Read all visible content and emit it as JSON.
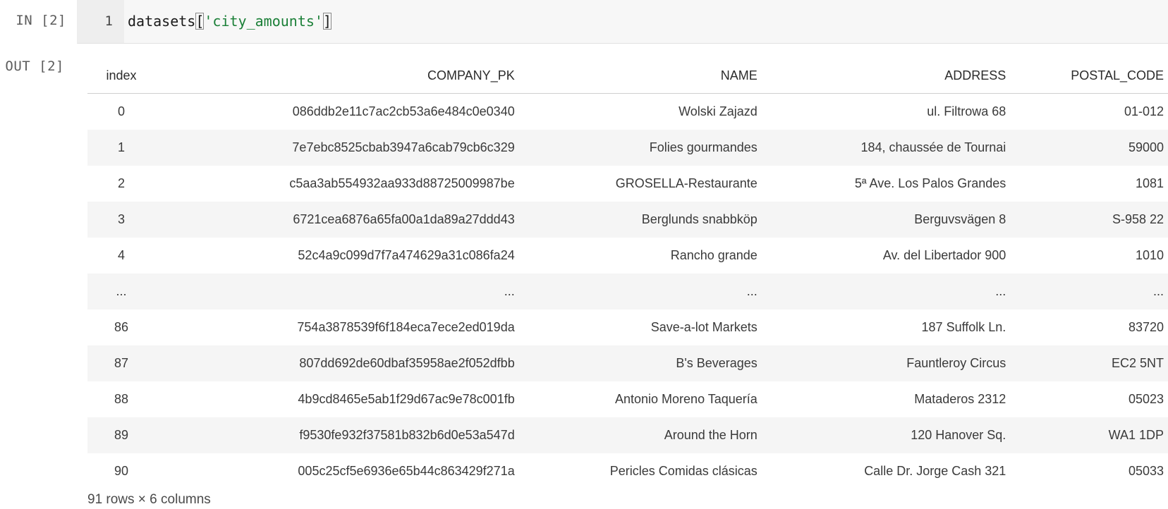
{
  "prompts": {
    "input": "IN [2]",
    "output": "OUT [2]"
  },
  "input_cell": {
    "line_number": "1",
    "code": {
      "prefix": "datasets",
      "open_bracket": "[",
      "string": "'city_amounts'",
      "close_bracket": "]"
    }
  },
  "table": {
    "headers": [
      "index",
      "COMPANY_PK",
      "NAME",
      "ADDRESS",
      "POSTAL_CODE"
    ],
    "rows": [
      [
        "0",
        "086ddb2e11c7ac2cb53a6e484c0e0340",
        "Wolski Zajazd",
        "ul. Filtrowa 68",
        "01-012"
      ],
      [
        "1",
        "7e7ebc8525cbab3947a6cab79cb6c329",
        "Folies gourmandes",
        "184, chaussée de Tournai",
        "59000"
      ],
      [
        "2",
        "c5aa3ab554932aa933d88725009987be",
        "GROSELLA-Restaurante",
        "5ª Ave. Los Palos Grandes",
        "1081"
      ],
      [
        "3",
        "6721cea6876a65fa00a1da89a27ddd43",
        "Berglunds snabbköp",
        "Berguvsvägen 8",
        "S-958 22"
      ],
      [
        "4",
        "52c4a9c099d7f7a474629a31c086fa24",
        "Rancho grande",
        "Av. del Libertador 900",
        "1010"
      ],
      [
        "...",
        "...",
        "...",
        "...",
        "..."
      ],
      [
        "86",
        "754a3878539f6f184eca7ece2ed019da",
        "Save-a-lot Markets",
        "187 Suffolk Ln.",
        "83720"
      ],
      [
        "87",
        "807dd692de60dbaf35958ae2f052dfbb",
        "B's Beverages",
        "Fauntleroy Circus",
        "EC2 5NT"
      ],
      [
        "88",
        "4b9cd8465e5ab1f29d67ac9e78c001fb",
        "Antonio Moreno Taquería",
        "Mataderos 2312",
        "05023"
      ],
      [
        "89",
        "f9530fe932f37581b832b6d0e53a547d",
        "Around the Horn",
        "120 Hanover Sq.",
        "WA1 1DP"
      ],
      [
        "90",
        "005c25cf5e6936e65b44c863429f271a",
        "Pericles Comidas clásicas",
        "Calle Dr. Jorge Cash 321",
        "05033"
      ]
    ]
  },
  "shape_note": "91 rows × 6 columns",
  "colors": {
    "string": "#1a7f37",
    "stripe": "#f5f5f5",
    "input_bg": "#f7f7f7"
  }
}
